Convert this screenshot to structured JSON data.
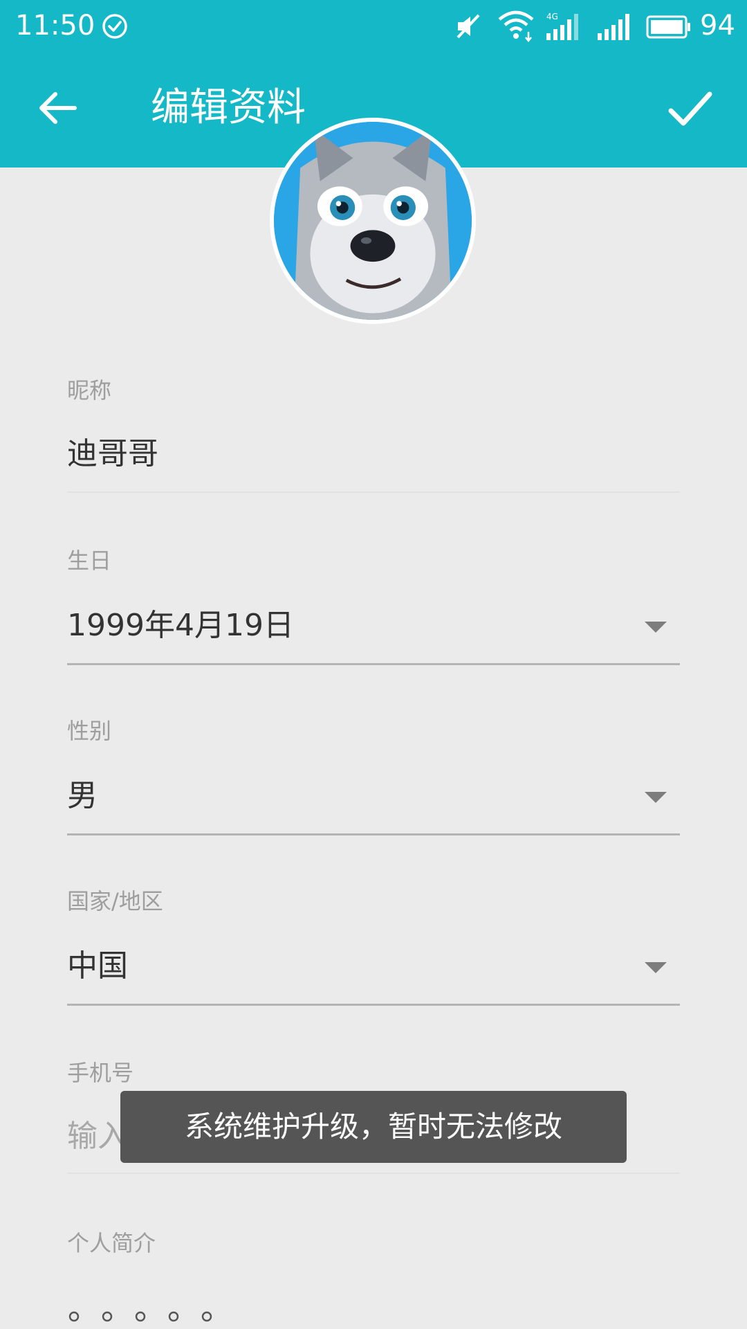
{
  "status_bar": {
    "time": "11:50",
    "network_label": "4G",
    "battery_percent": "94"
  },
  "toolbar": {
    "title": "编辑资料"
  },
  "form": {
    "nickname": {
      "label": "昵称",
      "value": "迪哥哥"
    },
    "birthday": {
      "label": "生日",
      "value": "1999年4月19日"
    },
    "gender": {
      "label": "性别",
      "value": "男"
    },
    "region": {
      "label": "国家/地区",
      "value": "中国"
    },
    "phone": {
      "label": "手机号",
      "placeholder": "输入手机号"
    },
    "bio": {
      "label": "个人简介"
    }
  },
  "toast": {
    "message": "系统维护升级，暂时无法修改"
  },
  "colors": {
    "primary": "#14b8c6",
    "background": "#ebebeb",
    "toast": "#555555"
  }
}
